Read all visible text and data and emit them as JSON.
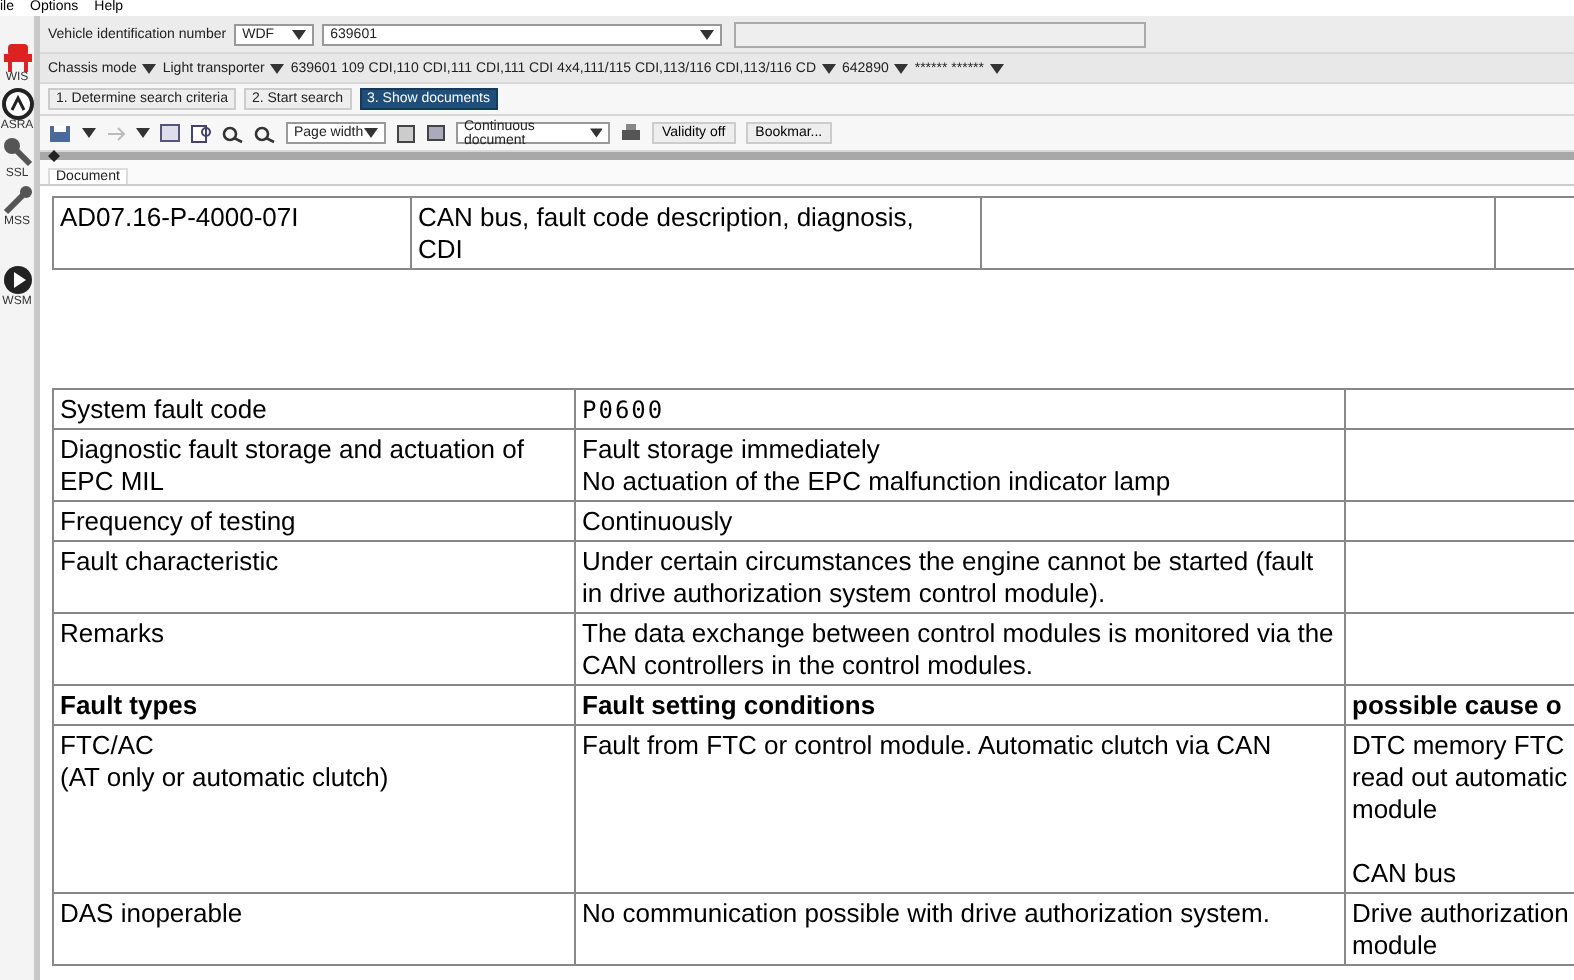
{
  "menu": [
    "ile",
    "Options",
    "Help"
  ],
  "sidebar": [
    {
      "label": "WIS"
    },
    {
      "label": "ASRA"
    },
    {
      "label": "SSL"
    },
    {
      "label": "MSS"
    },
    {
      "label": "WSM"
    }
  ],
  "vin": {
    "label": "Vehicle identification number",
    "prefix": "WDF",
    "value": "639601"
  },
  "chassis": [
    "Chassis mode",
    "Light transporter",
    "639601 109 CDI,110 CDI,111 CDI,111 CDI 4x4,111/115 CDI,113/116 CDI,113/116 CD",
    "642890",
    "****** ******"
  ],
  "steps": [
    {
      "label": "1. Determine search criteria",
      "selected": false
    },
    {
      "label": "2. Start search",
      "selected": false
    },
    {
      "label": "3. Show documents",
      "selected": true
    }
  ],
  "toolbar": {
    "zoom": "Page width",
    "view": "Continuous document",
    "buttons": [
      "Validity off",
      "Bookmar..."
    ]
  },
  "doc_tab": "Document",
  "header_table": {
    "code": "AD07.16-P-4000-07I",
    "title": "CAN bus, fault code description, diagnosis, CDI"
  },
  "info_rows": [
    {
      "label": "System fault code",
      "value": [
        "P0600"
      ]
    },
    {
      "label": "Diagnostic fault storage and actuation of EPC MIL",
      "value": [
        "Fault storage immediately",
        "No actuation of the EPC malfunction indicator lamp"
      ]
    },
    {
      "label": "Frequency of testing",
      "value": [
        "Continuously"
      ]
    },
    {
      "label": "Fault characteristic",
      "value": [
        "Under certain circumstances the engine cannot be started (fault in drive authorization system control module)."
      ]
    },
    {
      "label": "Remarks",
      "value": [
        "The data exchange between control modules is monitored via the CAN controllers in the control modules."
      ]
    }
  ],
  "fault_table": {
    "columns": [
      "Fault types",
      "Fault setting conditions",
      "possible cause o"
    ],
    "rows": [
      {
        "type": [
          "FTC/AC",
          "(AT only or automatic clutch)"
        ],
        "condition": [
          "Fault from FTC or control module. Automatic clutch via CAN"
        ],
        "cause": [
          "DTC memory FTC\nread out automatic\nmodule",
          "CAN bus"
        ]
      },
      {
        "type": [
          "DAS inoperable"
        ],
        "condition": [
          "No communication possible with drive authorization system."
        ],
        "cause": [
          "Drive authorization\nmodule"
        ]
      }
    ]
  }
}
